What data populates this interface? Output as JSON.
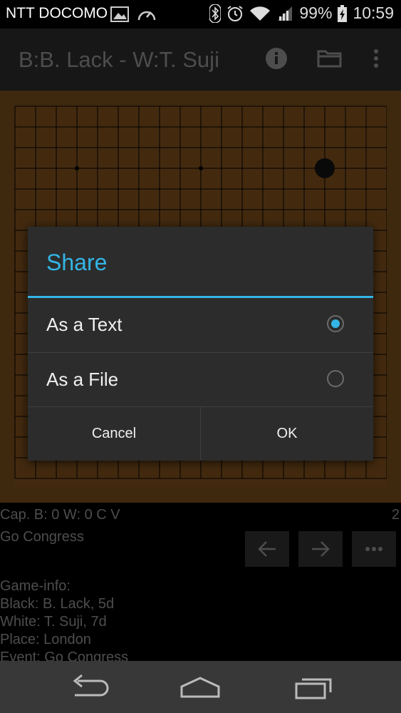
{
  "status_bar": {
    "carrier": "NTT DOCOMO",
    "battery": "99%",
    "time": "10:59"
  },
  "action_bar": {
    "title": "B:B. Lack - W:T. Suji",
    "icons": [
      "info-icon",
      "folder-icon",
      "overflow-menu-icon"
    ]
  },
  "info": {
    "captures": "Cap. B: 0  W: 0  C  V",
    "move_number": "2",
    "event_short": "Go Congress",
    "game_info_header": "Game-info:",
    "black": "Black: B. Lack, 5d",
    "white": "White: T. Suji, 7d",
    "place": "Place: London",
    "event": "Event: Go Congress"
  },
  "dialog": {
    "title": "Share",
    "options": [
      {
        "label": "As a Text",
        "selected": true
      },
      {
        "label": "As a File",
        "selected": false
      }
    ],
    "cancel_label": "Cancel",
    "ok_label": "OK"
  },
  "colors": {
    "accent": "#33b5e5",
    "board": "#7a4e1d"
  }
}
